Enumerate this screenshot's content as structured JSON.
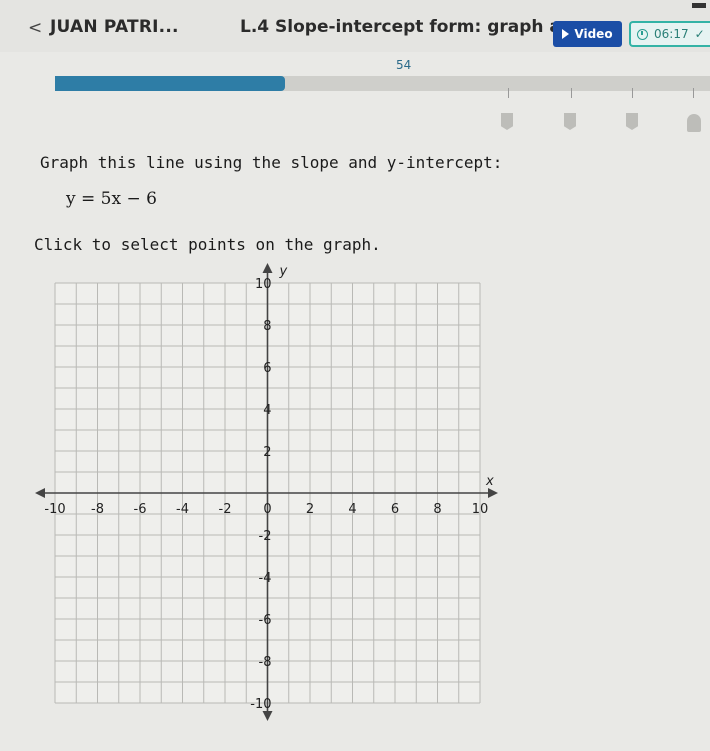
{
  "header": {
    "back_glyph": "<",
    "student_name": "JUAN PATRI...",
    "skill_title": "L.4 Slope-intercept form: graph an...",
    "video_label": "Video",
    "timer": "06:17",
    "timer_chevron": "✓"
  },
  "progress": {
    "label": "54",
    "fraction": 0.54
  },
  "colors": {
    "accent_blue": "#1b4ea6",
    "progress_blue": "#2e7da6",
    "timer_teal": "#33b3a6"
  },
  "icons": {
    "play": "play-icon",
    "clock": "clock-icon",
    "medal": "medal-icon",
    "trophy": "trophy-icon"
  },
  "question": {
    "prompt": "Graph this line using the slope and y-intercept:",
    "equation": "y = 5x − 6",
    "instruction": "Click to select points on the graph."
  },
  "chart_data": {
    "type": "scatter",
    "title": "",
    "xlabel": "x",
    "ylabel": "y",
    "xlim": [
      -10,
      10
    ],
    "ylim": [
      -10,
      10
    ],
    "grid": true,
    "x_ticks": [
      "-10",
      "-8",
      "-6",
      "-4",
      "-2",
      "0",
      "2",
      "4",
      "6",
      "8",
      "10"
    ],
    "y_ticks": [
      "10",
      "8",
      "6",
      "4",
      "2",
      "-2",
      "-4",
      "-6",
      "-8",
      "-10"
    ],
    "series": []
  }
}
